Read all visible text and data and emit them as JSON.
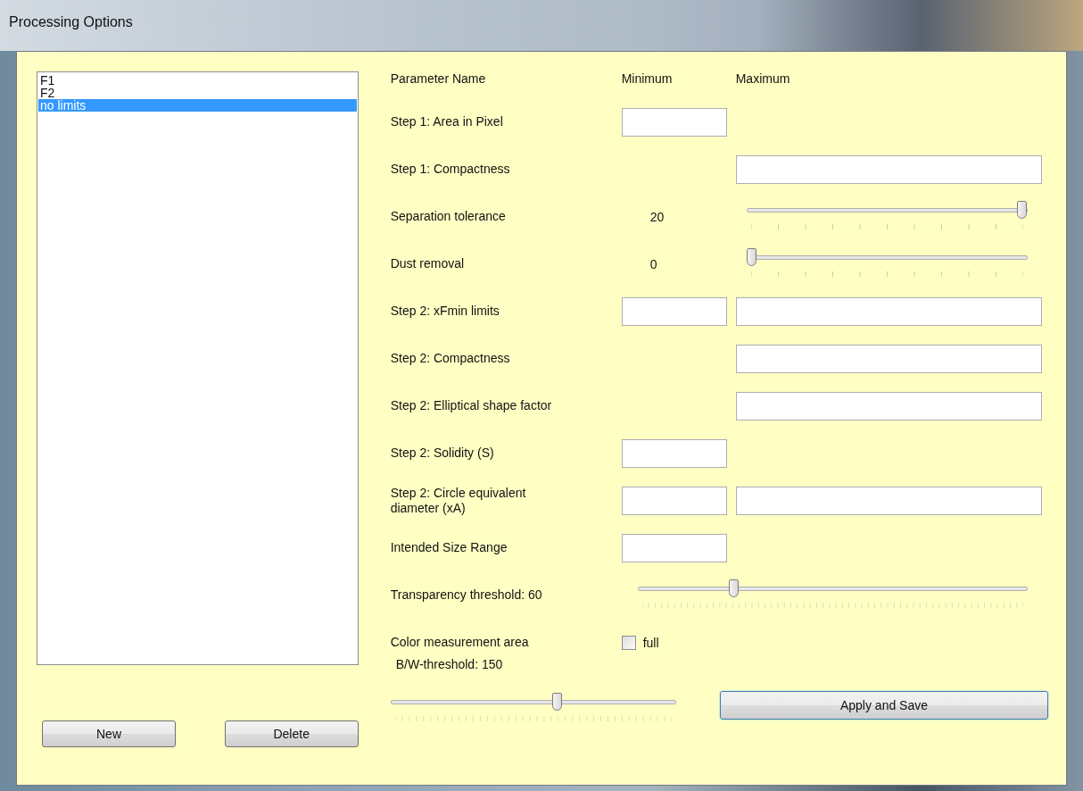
{
  "window": {
    "title": "Processing Options"
  },
  "profiles": [
    {
      "label": "F1",
      "selected": false
    },
    {
      "label": "F2",
      "selected": false
    },
    {
      "label": "no limits",
      "selected": true
    }
  ],
  "buttons": {
    "new": "New",
    "delete": "Delete",
    "apply": "Apply and Save"
  },
  "columns": {
    "name": "Parameter Name",
    "minimum": "Minimum",
    "maximum": "Maximum"
  },
  "parameters": [
    {
      "kind": "fields",
      "label": "Step 1: Area in Pixel",
      "has_minimum": true,
      "has_maximum": false
    },
    {
      "kind": "fields",
      "label": "Step 1: Compactness",
      "has_minimum": false,
      "has_maximum": true
    },
    {
      "kind": "slider",
      "label": "Separation tolerance",
      "value": "20",
      "level": 1
    },
    {
      "kind": "slider",
      "label": "Dust removal",
      "value": "0",
      "level": 0
    },
    {
      "kind": "fields",
      "label": "Step 2: xFmin limits",
      "has_minimum": true,
      "has_maximum": true
    },
    {
      "kind": "fields",
      "label": "Step 2: Compactness",
      "has_minimum": false,
      "has_maximum": true
    },
    {
      "kind": "fields",
      "label": "Step 2: Elliptical shape factor",
      "has_minimum": false,
      "has_maximum": true
    },
    {
      "kind": "fields",
      "label": "Step 2: Solidity (S)",
      "has_minimum": true,
      "has_maximum": false
    },
    {
      "kind": "fields",
      "label": "Step 2: Circle equivalent diameter (xA)",
      "has_minimum": true,
      "has_maximum": true
    },
    {
      "kind": "fields",
      "label": "Intended Size Range",
      "has_minimum": true,
      "has_maximum": false
    },
    {
      "kind": "wide_slider",
      "label": "Transparency threshold: 60",
      "level": 0.24
    },
    {
      "kind": "checkbox",
      "label": "Color measurement area",
      "option": "full",
      "checked": false
    }
  ],
  "bw_threshold": {
    "label": "B/W-threshold: 150",
    "level": 0.59
  }
}
